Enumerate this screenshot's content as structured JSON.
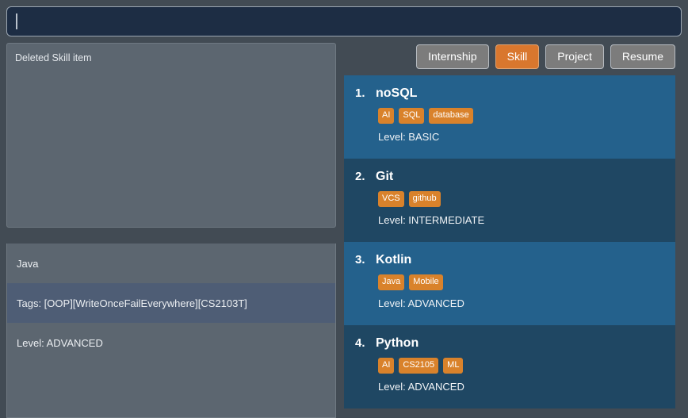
{
  "command_box": {
    "value": "",
    "placeholder": "Enter command here...",
    "caret_visible": true
  },
  "result_display": {
    "message": "Deleted Skill item"
  },
  "detail_panel": {
    "rows": [
      {
        "text": "Java",
        "highlighted": false
      },
      {
        "text": "Tags: [OOP][WriteOnceFailEverywhere][CS2103T]",
        "highlighted": true
      },
      {
        "text": "Level: ADVANCED",
        "highlighted": false
      }
    ]
  },
  "tabs": [
    {
      "label": "Internship",
      "active": false
    },
    {
      "label": "Skill",
      "active": true
    },
    {
      "label": "Project",
      "active": false
    },
    {
      "label": "Resume",
      "active": false
    }
  ],
  "cards": [
    {
      "index": "1.",
      "title": "noSQL",
      "tags": [
        "AI",
        "SQL",
        "database"
      ],
      "level": "Level: BASIC"
    },
    {
      "index": "2.",
      "title": "Git",
      "tags": [
        "VCS",
        "github"
      ],
      "level": "Level: INTERMEDIATE"
    },
    {
      "index": "3.",
      "title": "Kotlin",
      "tags": [
        "Java",
        "Mobile"
      ],
      "level": "Level: ADVANCED"
    },
    {
      "index": "4.",
      "title": "Python",
      "tags": [
        "AI",
        "CS2105",
        "ML"
      ],
      "level": "Level: ADVANCED"
    }
  ],
  "colors": {
    "background": "#424b54",
    "command_background": "#1d2d44",
    "panel_grey": "#5c6670",
    "highlight_row": "#4e5d75",
    "card_light": "#24618c",
    "card_dark": "#1f4763",
    "accent_orange": "#d9772e",
    "tag_orange": "#d9822b",
    "tab_inactive": "#7c7c7c"
  }
}
